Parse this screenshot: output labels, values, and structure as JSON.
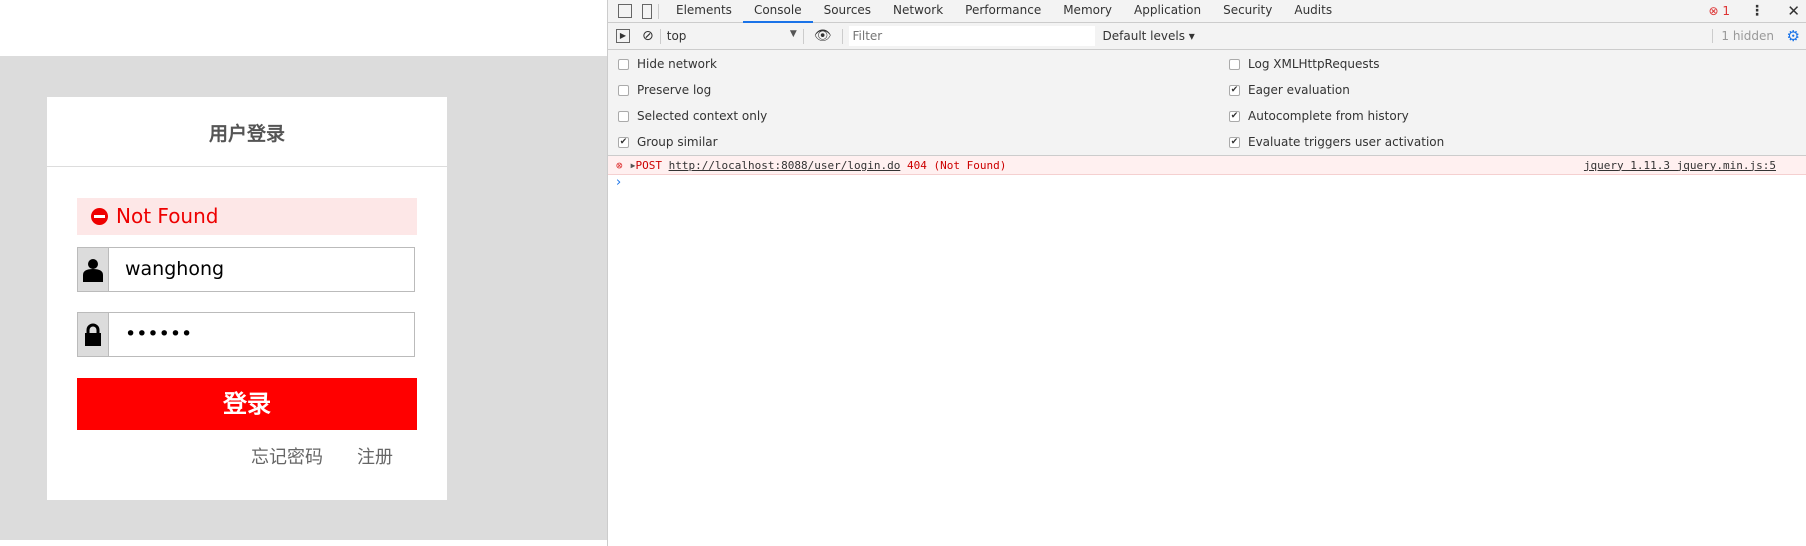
{
  "login": {
    "title": "用户登录",
    "alert": "Not Found",
    "username": "wanghong",
    "password": "••••••",
    "submit": "登录",
    "forgot": "忘记密码",
    "register": "注册"
  },
  "devtools": {
    "tabs": [
      "Elements",
      "Console",
      "Sources",
      "Network",
      "Performance",
      "Memory",
      "Application",
      "Security",
      "Audits"
    ],
    "active_tab": "Console",
    "error_count": "1",
    "context": "top",
    "filter_placeholder": "Filter",
    "levels": "Default levels ▾",
    "hidden": "1 hidden",
    "settings_left": [
      {
        "label": "Hide network",
        "checked": false
      },
      {
        "label": "Preserve log",
        "checked": false
      },
      {
        "label": "Selected context only",
        "checked": false
      },
      {
        "label": "Group similar",
        "checked": true
      }
    ],
    "settings_right": [
      {
        "label": "Log XMLHttpRequests",
        "checked": false
      },
      {
        "label": "Eager evaluation",
        "checked": true
      },
      {
        "label": "Autocomplete from history",
        "checked": true
      },
      {
        "label": "Evaluate triggers user activation",
        "checked": true
      }
    ],
    "error": {
      "method": "POST",
      "url": "http://localhost:8088/user/login.do",
      "status": "404 (Not Found)",
      "source": "jquery 1.11.3 jquery.min.js:5"
    },
    "prompt": "›"
  }
}
